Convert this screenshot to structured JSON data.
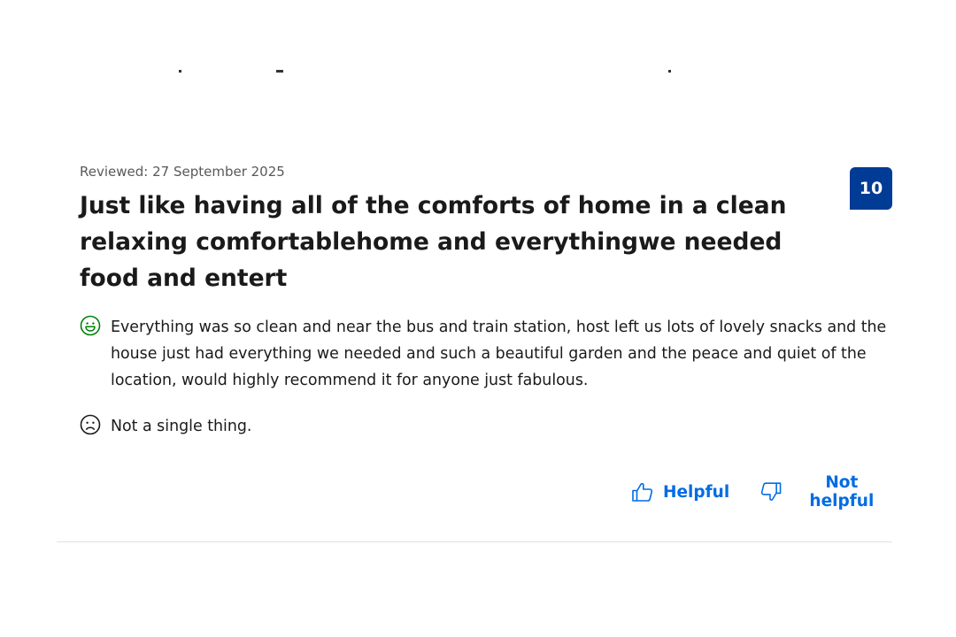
{
  "review": {
    "reviewed_date": "Reviewed: 27 September 2025",
    "title": "Just like having all of the comforts of home in a clean relaxing comfortablehome and everythingwe needed food and entert",
    "score": "10",
    "positive_text": "Everything was so clean and near the bus and train station, host left us lots of lovely snacks and the house just had everything we needed and such a beautiful garden and the peace and quiet of the location, would highly recommend it for anyone just fabulous.",
    "negative_text": "Not a single thing."
  },
  "actions": {
    "helpful_label": "Helpful",
    "not_helpful_label": "Not helpful"
  },
  "colors": {
    "score_bg": "#003b95",
    "link": "#006ce4",
    "positive_icon": "#008009",
    "negative_icon": "#1a1a1a"
  },
  "icons": {
    "positive": "smiley-face-icon",
    "negative": "sad-face-icon",
    "helpful": "thumbs-up-icon",
    "not_helpful": "thumbs-down-icon"
  }
}
